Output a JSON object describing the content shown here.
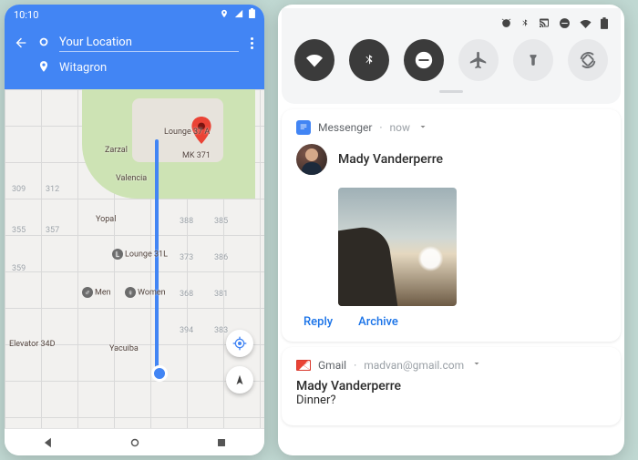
{
  "left": {
    "statusbar": {
      "time": "10:10"
    },
    "directions": {
      "origin_placeholder": "Your Location",
      "destination": "Witagron"
    },
    "map": {
      "labels": {
        "lounge37a": "Lounge 37 A",
        "mk371": "MK 371",
        "zarzal": "Zarzal",
        "valencia": "Valencia",
        "yopal": "Yopal",
        "lounge31l": "Lounge 31L",
        "women": "Women",
        "men": "Men",
        "yacuiba": "Yacuiba",
        "elevator34d": "Elevator 34D"
      },
      "rooms": [
        "309",
        "312",
        "355",
        "357",
        "359",
        "388",
        "385",
        "373",
        "386",
        "368",
        "381",
        "394",
        "383"
      ]
    }
  },
  "right": {
    "messenger": {
      "app": "Messenger",
      "time": "now",
      "sender": "Mady Vanderperre",
      "actions": {
        "reply": "Reply",
        "archive": "Archive"
      }
    },
    "gmail": {
      "app": "Gmail",
      "account": "madvan@gmail.com",
      "sender": "Mady Vanderperre",
      "subject": "Dinner?"
    }
  }
}
